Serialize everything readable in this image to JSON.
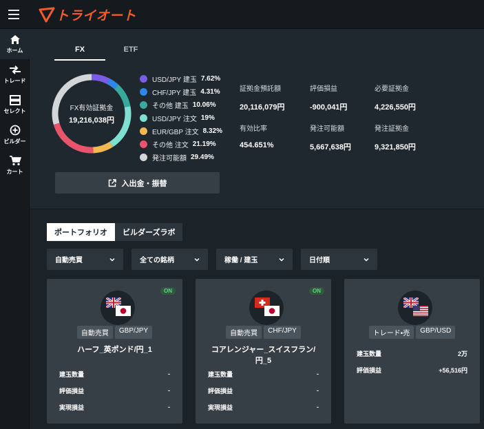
{
  "header": {
    "logo_text": "トライオート"
  },
  "nav": [
    {
      "label": "ホーム",
      "icon": "home-icon"
    },
    {
      "label": "トレード",
      "icon": "trade-arrows-icon"
    },
    {
      "label": "セレクト",
      "icon": "select-icon"
    },
    {
      "label": "ビルダー",
      "icon": "builder-plus-icon"
    },
    {
      "label": "カート",
      "icon": "cart-icon"
    }
  ],
  "summary": {
    "tabs": [
      "FX",
      "ETF"
    ],
    "donut": {
      "label": "FX有効証拠金",
      "value": "19,216,038円"
    },
    "legend": [
      {
        "name": "USD/JPY 建玉",
        "pct": "7.62%",
        "color": "#7b5ce6",
        "value": 7.62
      },
      {
        "name": "CHF/JPY 建玉",
        "pct": "4.31%",
        "color": "#2f86e6",
        "value": 4.31
      },
      {
        "name": "その他 建玉",
        "pct": "10.06%",
        "color": "#38a99a",
        "value": 10.06
      },
      {
        "name": "USD/JPY 注文",
        "pct": "19%",
        "color": "#7fe0d2",
        "value": 19
      },
      {
        "name": "EUR/GBP 注文",
        "pct": "8.32%",
        "color": "#f2b950",
        "value": 8.32
      },
      {
        "name": "その他 注文",
        "pct": "21.19%",
        "color": "#e8546c",
        "value": 21.19
      },
      {
        "name": "発注可能額",
        "pct": "29.49%",
        "color": "#d3d6d8",
        "value": 29.49
      }
    ],
    "metrics": [
      {
        "label": "証拠金預託額",
        "value": "20,116,079円"
      },
      {
        "label": "評価損益",
        "value": "-900,041円"
      },
      {
        "label": "必要証拠金",
        "value": "4,226,550円"
      },
      {
        "label": "有効比率",
        "value": "454.651%"
      },
      {
        "label": "発注可能額",
        "value": "5,667,638円"
      },
      {
        "label": "発注証拠金",
        "value": "9,321,850円"
      }
    ],
    "deposit_button": "入出金・振替"
  },
  "portfolio": {
    "tabs": [
      "ポートフォリオ",
      "ビルダーズラボ"
    ],
    "filters": [
      "自動売買",
      "全ての銘柄",
      "稼働 / 建玉",
      "日付順"
    ],
    "cards": [
      {
        "on": "ON",
        "badge1": "自動売買",
        "badge2": "GBP/JPY",
        "name": "ハーフ_英ポンド/円_1",
        "stats": [
          {
            "label": "建玉数量",
            "value": "-"
          },
          {
            "label": "評価損益",
            "value": "-"
          },
          {
            "label": "実現損益",
            "value": "-"
          }
        ]
      },
      {
        "on": "ON",
        "badge1": "自動売買",
        "badge2": "CHF/JPY",
        "name": "コアレンジャー_スイスフラン/円_5",
        "stats": [
          {
            "label": "建玉数量",
            "value": "-"
          },
          {
            "label": "評価損益",
            "value": "-"
          },
          {
            "label": "実現損益",
            "value": "-"
          }
        ]
      },
      {
        "badge1": "トレード•売",
        "badge2": "GBP/USD",
        "stats": [
          {
            "label": "建玉数量",
            "value": "2万"
          },
          {
            "label": "評価損益",
            "value": "+56,516円"
          }
        ]
      }
    ]
  }
}
